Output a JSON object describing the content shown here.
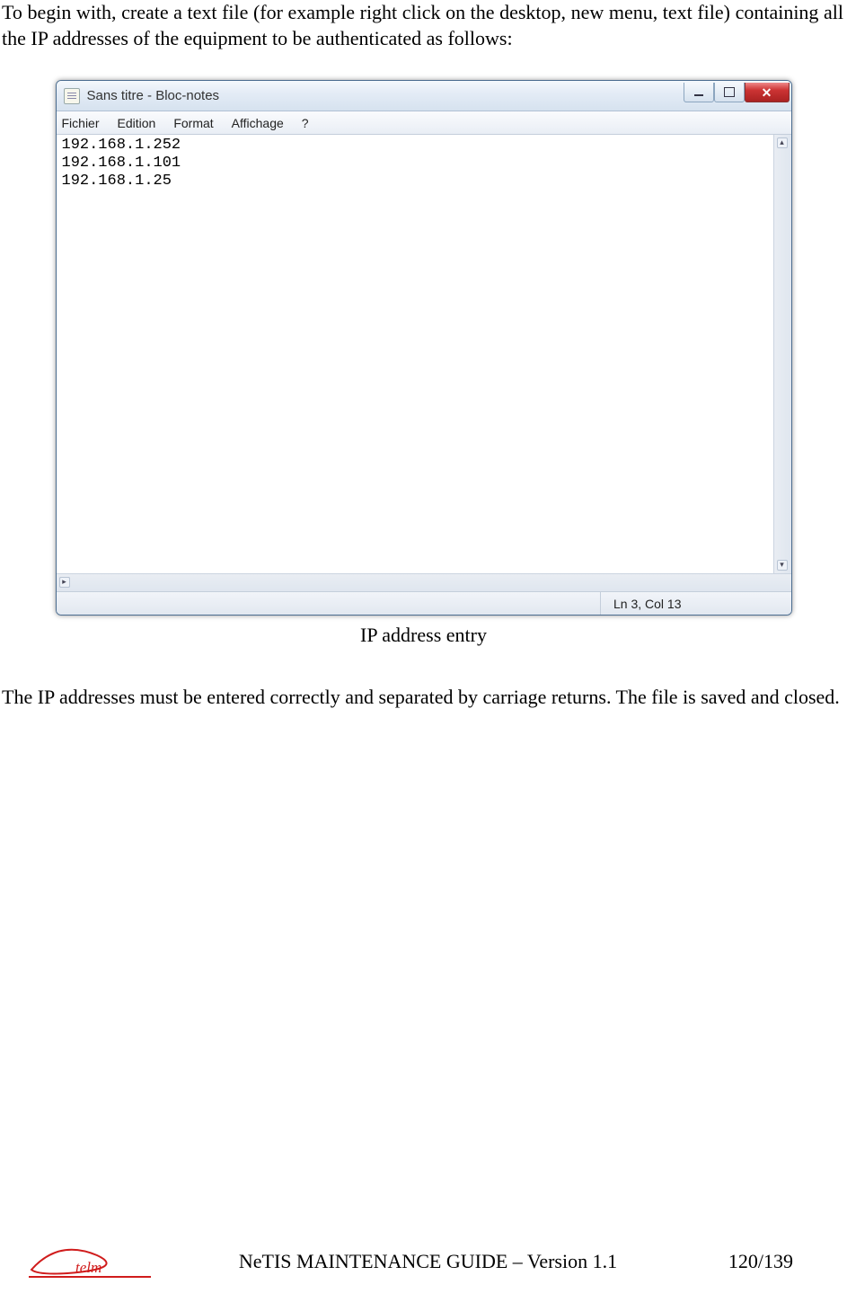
{
  "para1": "To begin with, create a text file (for example right click on the desktop, new menu, text file) containing all the IP addresses of the equipment to be authenticated as follows:",
  "notepad": {
    "title": "Sans titre - Bloc-notes",
    "menus": {
      "m1": "Fichier",
      "m2": "Edition",
      "m3": "Format",
      "m4": "Affichage",
      "m5": "?"
    },
    "content": "192.168.1.252\n192.168.1.101\n192.168.1.25",
    "status": "Ln 3, Col 13"
  },
  "caption": "IP address entry",
  "para2": "The IP addresses must be entered correctly and separated by carriage returns. The file is saved and closed.",
  "footer": {
    "doc_title": "NeTIS MAINTENANCE GUIDE – Version 1.1",
    "page": "120/139",
    "logo_text": "telm"
  }
}
